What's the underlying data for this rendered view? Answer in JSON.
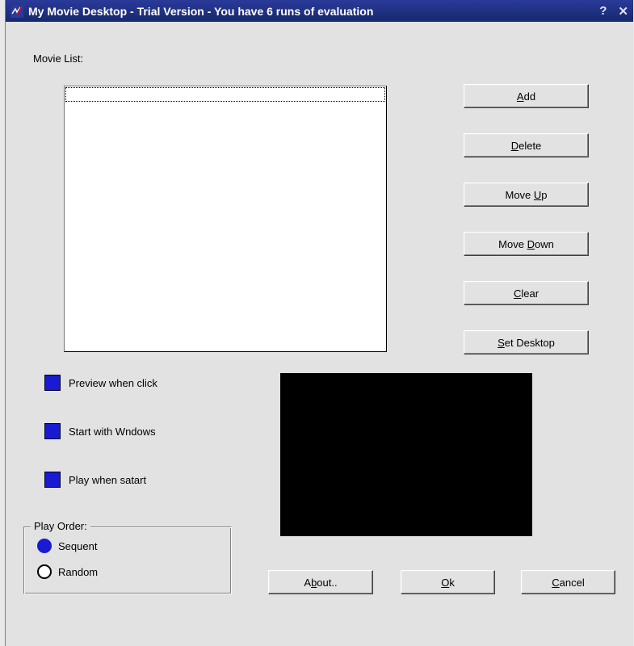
{
  "window": {
    "title": "My Movie Desktop - Trial Version - You have 6 runs of evaluation"
  },
  "labels": {
    "movie_list": "Movie List:"
  },
  "buttons": {
    "add": {
      "pre": "",
      "u": "A",
      "post": "dd"
    },
    "delete": {
      "pre": "",
      "u": "D",
      "post": "elete"
    },
    "move_up": {
      "pre": "Move ",
      "u": "U",
      "post": "p"
    },
    "move_down": {
      "pre": "Move ",
      "u": "D",
      "post": "own"
    },
    "clear": {
      "pre": "",
      "u": "C",
      "post": "lear"
    },
    "set_desktop": {
      "pre": "",
      "u": "S",
      "post": "et Desktop"
    },
    "about": {
      "pre": "A",
      "u": "b",
      "post": "out.."
    },
    "ok": {
      "pre": "",
      "u": "O",
      "post": "k"
    },
    "cancel": {
      "pre": "",
      "u": "C",
      "post": "ancel"
    }
  },
  "checkboxes": {
    "preview": "Preview when click",
    "startwin": "Start with Wndows",
    "playstart": "Play when satart"
  },
  "group": {
    "legend": "Play Order:",
    "sequent": "Sequent",
    "random": "Random"
  }
}
